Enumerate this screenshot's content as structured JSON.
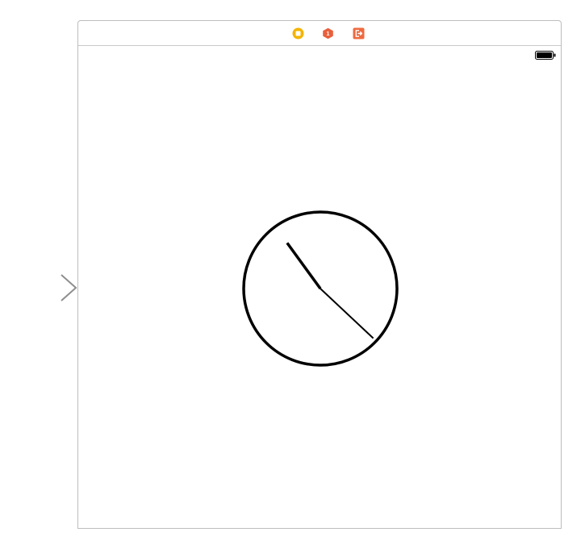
{
  "storyboard": {
    "initial_arrow": "initial-scene-arrow",
    "dock": {
      "icons": [
        "view-controller-icon",
        "first-responder-icon",
        "exit-icon"
      ],
      "colors": {
        "view_controller": "#f4b400",
        "first_responder": "#e8603c",
        "exit": "#ef6a3f"
      }
    },
    "status_bar": {
      "battery_icon": "battery-icon",
      "battery_level": 1.0
    }
  },
  "scene": {
    "clock": {
      "stroke_color": "#000000",
      "hour_hand_time_position": 10.8,
      "minute_hand_time_position": 22.2
    }
  }
}
